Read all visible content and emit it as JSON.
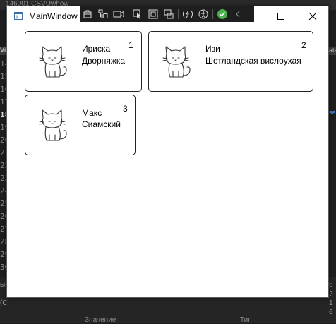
{
  "window": {
    "title": "MainWindow"
  },
  "debug_toolbar": {
    "icons": [
      "toolbox-icon",
      "live-visual-tree-icon",
      "video-icon",
      "select-element-icon",
      "display-layout-adorners-icon",
      "track-focus-icon",
      "hot-reload-icon",
      "accessibility-icon",
      "check-icon",
      "collapse-chevron-icon"
    ]
  },
  "background": {
    "top_text": "146001 CSVUwhow",
    "left_tab": "Vie",
    "left_line_numbers": [
      "14",
      "15",
      "16",
      "17",
      "18",
      "19",
      "20",
      "21",
      "22",
      "23",
      "24",
      "25",
      "26",
      "27",
      "28",
      "29",
      "30"
    ],
    "active_line": "18",
    "right_tab": "ata",
    "right_link": "sa",
    "bottom_left_1": "ые",
    "bottom_left_2": "(C",
    "bottom_col_value": "Значение",
    "bottom_col_type": "Тип",
    "bottom_right": [
      "6",
      "?",
      "1",
      "6"
    ]
  },
  "cats": [
    {
      "name": "Ириска",
      "breed": "Дворняжка",
      "number": "1"
    },
    {
      "name": "Изи",
      "breed": "Шотландская вислоухая",
      "number": "2"
    },
    {
      "name": "Макс",
      "breed": "Сиамский",
      "number": "3"
    }
  ],
  "colors": {
    "window_bg": "#ffffff",
    "ide_bg": "#1e1e1e",
    "toolbar_bg": "#1e1e1e",
    "check_green": "#4caf50"
  }
}
